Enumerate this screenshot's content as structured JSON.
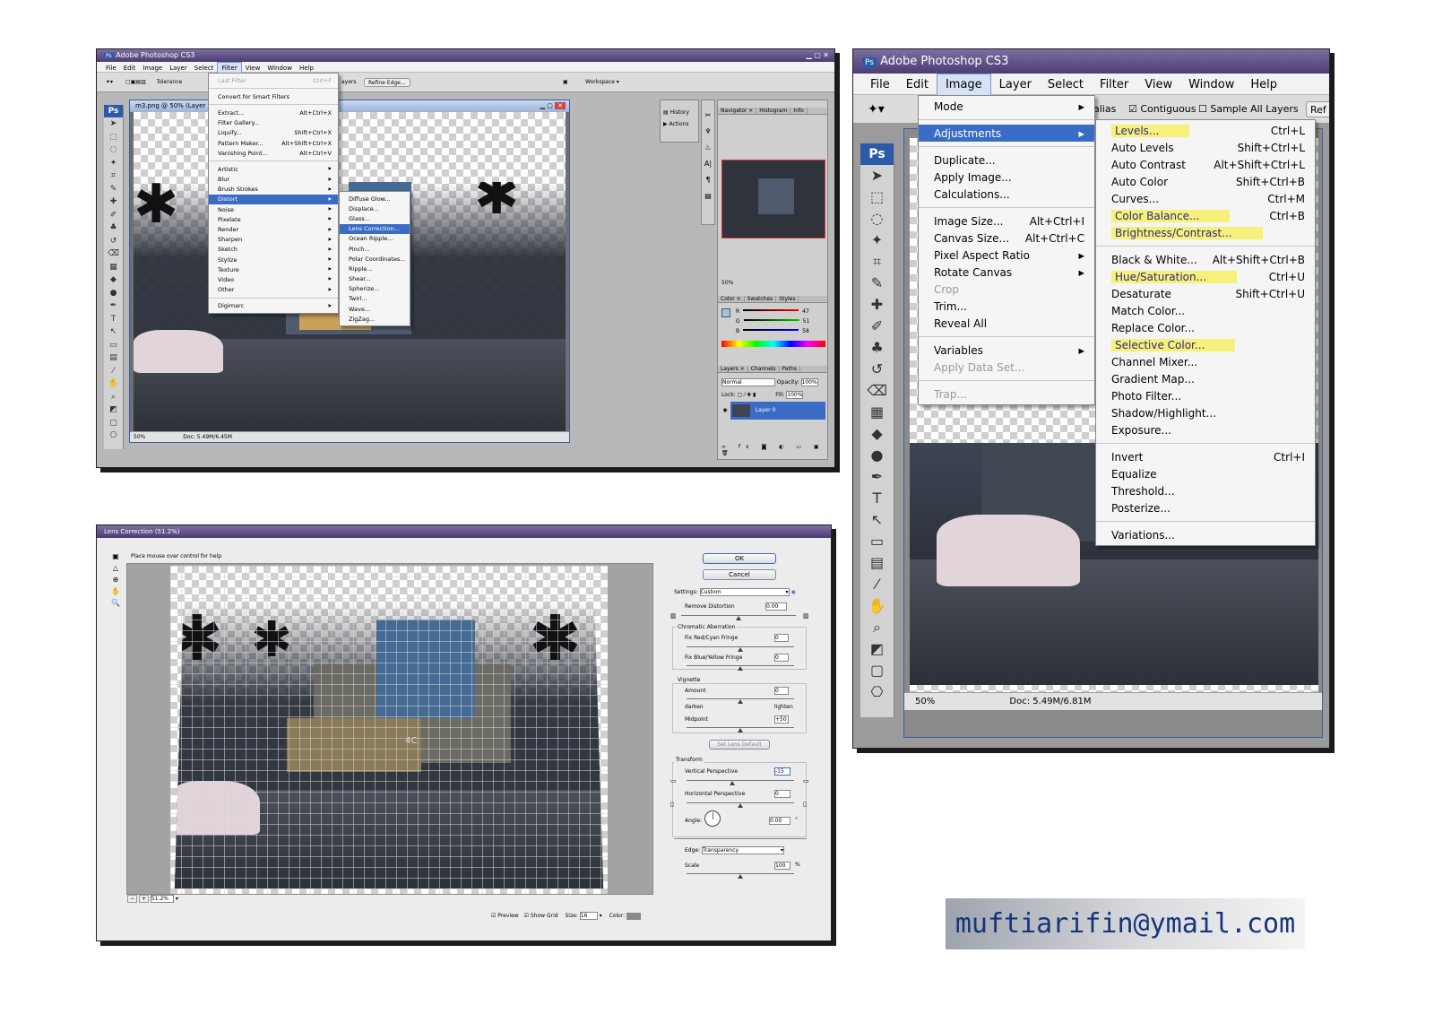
{
  "p1": {
    "title": "Adobe Photoshop CS3",
    "menus": [
      "File",
      "Edit",
      "Image",
      "Layer",
      "Select",
      "Filter",
      "View",
      "Window",
      "Help"
    ],
    "tolerance_label": "Tolerance",
    "layers_label": "ayers",
    "refine_edge": "Refine Edge...",
    "workspace": "Workspace ▾",
    "doc_title": "m3.png @ 50% (Layer 0",
    "zoom": "50%",
    "doc_size": "Doc: 5.49M/6.45M",
    "filter_menu": [
      {
        "label": "Last Filter",
        "shortcut": "Ctrl+F",
        "dis": true
      },
      {
        "sep": true
      },
      {
        "label": "Convert for Smart Filters"
      },
      {
        "sep": true
      },
      {
        "label": "Extract...",
        "shortcut": "Alt+Ctrl+X"
      },
      {
        "label": "Filter Gallery..."
      },
      {
        "label": "Liquify...",
        "shortcut": "Shift+Ctrl+X"
      },
      {
        "label": "Pattern Maker...",
        "shortcut": "Alt+Shift+Ctrl+X"
      },
      {
        "label": "Vanishing Point...",
        "shortcut": "Alt+Ctrl+V"
      },
      {
        "sep": true
      },
      {
        "label": "Artistic",
        "sub": true
      },
      {
        "label": "Blur",
        "sub": true
      },
      {
        "label": "Brush Strokes",
        "sub": true
      },
      {
        "label": "Distort",
        "sub": true,
        "sel": true
      },
      {
        "label": "Noise",
        "sub": true
      },
      {
        "label": "Pixelate",
        "sub": true
      },
      {
        "label": "Render",
        "sub": true
      },
      {
        "label": "Sharpen",
        "sub": true
      },
      {
        "label": "Sketch",
        "sub": true
      },
      {
        "label": "Stylize",
        "sub": true
      },
      {
        "label": "Texture",
        "sub": true
      },
      {
        "label": "Video",
        "sub": true
      },
      {
        "label": "Other",
        "sub": true
      },
      {
        "sep": true
      },
      {
        "label": "Digimarc",
        "sub": true
      }
    ],
    "distort_menu": [
      {
        "label": "Diffuse Glow..."
      },
      {
        "label": "Displace..."
      },
      {
        "label": "Glass..."
      },
      {
        "label": "Lens Correction...",
        "sel": true
      },
      {
        "label": "Ocean Ripple..."
      },
      {
        "label": "Pinch..."
      },
      {
        "label": "Polar Coordinates..."
      },
      {
        "label": "Ripple..."
      },
      {
        "label": "Shear..."
      },
      {
        "label": "Spherize..."
      },
      {
        "label": "Twirl..."
      },
      {
        "label": "Wave..."
      },
      {
        "label": "ZigZag..."
      }
    ],
    "dock": {
      "history": "History",
      "actions": "Actions",
      "nav_tabs": [
        "Navigator ×",
        "Histogram",
        "Info"
      ],
      "nav_zoom": "50%",
      "color_tabs": [
        "Color ×",
        "Swatches",
        "Styles"
      ],
      "color_values": {
        "r": "47",
        "g": "51",
        "b": "58"
      },
      "color_labels": {
        "r": "R",
        "g": "G",
        "b": "B"
      },
      "layer_tabs": [
        "Layers ×",
        "Channels",
        "Paths"
      ],
      "blend": "Normal",
      "opacity_label": "Opacity:",
      "opacity": "100%",
      "lock_label": "Lock:",
      "fill_label": "Fill:",
      "fill": "100%",
      "layer_name": "Layer 0"
    }
  },
  "p2": {
    "title": "Adobe Photoshop CS3",
    "menus": [
      "File",
      "Edit",
      "Image",
      "Layer",
      "Select",
      "Filter",
      "View",
      "Window",
      "Help"
    ],
    "opts": {
      "alias": "alias",
      "contiguous": "Contiguous",
      "sample_all": "Sample All Layers",
      "ref": "Ref"
    },
    "zoom": "50%",
    "doc_size": "Doc: 5.49M/6.81M",
    "image_menu": [
      {
        "label": "Mode",
        "sub": true
      },
      {
        "sep": true
      },
      {
        "label": "Adjustments",
        "sub": true,
        "sel": true
      },
      {
        "sep": true
      },
      {
        "label": "Duplicate..."
      },
      {
        "label": "Apply Image..."
      },
      {
        "label": "Calculations..."
      },
      {
        "sep": true
      },
      {
        "label": "Image Size...",
        "shortcut": "Alt+Ctrl+I"
      },
      {
        "label": "Canvas Size...",
        "shortcut": "Alt+Ctrl+C"
      },
      {
        "label": "Pixel Aspect Ratio",
        "sub": true
      },
      {
        "label": "Rotate Canvas",
        "sub": true
      },
      {
        "label": "Crop",
        "dis": true
      },
      {
        "label": "Trim..."
      },
      {
        "label": "Reveal All"
      },
      {
        "sep": true
      },
      {
        "label": "Variables",
        "sub": true
      },
      {
        "label": "Apply Data Set...",
        "dis": true
      },
      {
        "sep": true
      },
      {
        "label": "Trap...",
        "dis": true
      }
    ],
    "adj_menu": [
      {
        "label": "Levels...",
        "shortcut": "Ctrl+L",
        "hl": true
      },
      {
        "label": "Auto Levels",
        "shortcut": "Shift+Ctrl+L"
      },
      {
        "label": "Auto Contrast",
        "shortcut": "Alt+Shift+Ctrl+L"
      },
      {
        "label": "Auto Color",
        "shortcut": "Shift+Ctrl+B"
      },
      {
        "label": "Curves...",
        "shortcut": "Ctrl+M"
      },
      {
        "label": "Color Balance...",
        "shortcut": "Ctrl+B",
        "hl": true
      },
      {
        "label": "Brightness/Contrast...",
        "hl": true
      },
      {
        "sep": true
      },
      {
        "label": "Black & White...",
        "shortcut": "Alt+Shift+Ctrl+B"
      },
      {
        "label": "Hue/Saturation...",
        "shortcut": "Ctrl+U",
        "hl": true
      },
      {
        "label": "Desaturate",
        "shortcut": "Shift+Ctrl+U"
      },
      {
        "label": "Match Color..."
      },
      {
        "label": "Replace Color..."
      },
      {
        "label": "Selective Color...",
        "hl": true
      },
      {
        "label": "Channel Mixer..."
      },
      {
        "label": "Gradient Map..."
      },
      {
        "label": "Photo Filter..."
      },
      {
        "label": "Shadow/Highlight..."
      },
      {
        "label": "Exposure..."
      },
      {
        "sep": true
      },
      {
        "label": "Invert",
        "shortcut": "Ctrl+I"
      },
      {
        "label": "Equalize"
      },
      {
        "label": "Threshold..."
      },
      {
        "label": "Posterize..."
      },
      {
        "sep": true
      },
      {
        "label": "Variations..."
      }
    ]
  },
  "p3": {
    "title": "Lens Correction (51.2%)",
    "hint": "Place mouse over control for help",
    "ok": "OK",
    "cancel": "Cancel",
    "settings_label": "Settings:",
    "settings_value": "Custom",
    "remove_distortion_label": "Remove Distortion",
    "remove_distortion_value": "0.00",
    "chromatic_label": "Chromatic Aberration",
    "fix_rc_label": "Fix Red/Cyan Fringe",
    "fix_rc_value": "0",
    "fix_by_label": "Fix Blue/Yellow Fringe",
    "fix_by_value": "0",
    "vignette_label": "Vignette",
    "amount_label": "Amount",
    "amount_value": "0",
    "darken": "darken",
    "lighten": "lighten",
    "midpoint_label": "Midpoint",
    "midpoint_value": "+50",
    "set_lens_default": "Set Lens Default",
    "transform_label": "Transform",
    "vp_label": "Vertical Perspective",
    "vp_value": "-15",
    "hp_label": "Horizontal Perspective",
    "hp_value": "0",
    "angle_label": "Angle:",
    "angle_value": "0.00",
    "angle_unit": "°",
    "edge_label": "Edge:",
    "edge_value": "Transparency",
    "scale_label": "Scale",
    "scale_value": "100",
    "scale_unit": "%",
    "zoom": "51.2%",
    "preview": "Preview",
    "show_grid": "Show Grid",
    "size_label": "Size:",
    "size_value": "16",
    "color_label": "Color:",
    "sign": "4C"
  },
  "email": "muftiarifin@ymail.com",
  "colors": {
    "selection": "#3a6cc6",
    "highlight": "#f7f07a",
    "title": "#4b3d73",
    "email_text": "#16357a"
  }
}
